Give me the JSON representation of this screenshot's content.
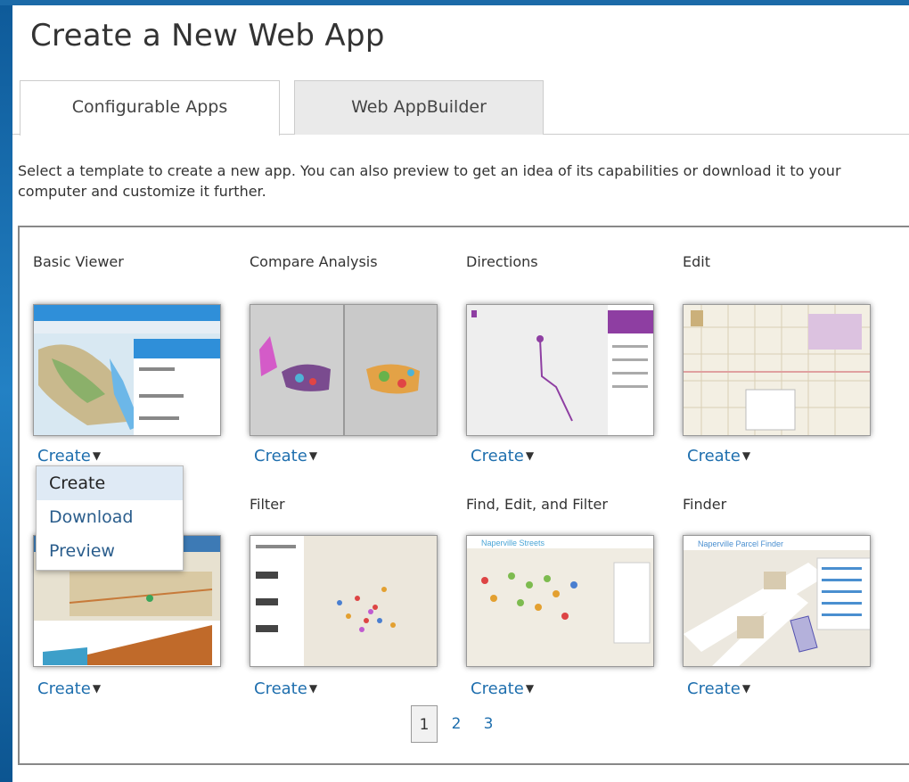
{
  "page": {
    "title": "Create a New Web App",
    "intro": "Select a template to create a new app. You can also preview to get an idea of its capabilities or download it to your computer and customize it further."
  },
  "tabs": [
    {
      "label": "Configurable Apps",
      "active": true
    },
    {
      "label": "Web AppBuilder",
      "active": false
    }
  ],
  "apps": [
    {
      "name": "Basic Viewer",
      "thumb": "map-thumbnail-basic-viewer"
    },
    {
      "name": "Compare Analysis",
      "thumb": "map-thumbnail-compare-analysis"
    },
    {
      "name": "Directions",
      "thumb": "map-thumbnail-directions"
    },
    {
      "name": "Edit",
      "thumb": "map-thumbnail-edit"
    },
    {
      "name": "",
      "thumb": "map-thumbnail-elevation"
    },
    {
      "name": "Filter",
      "thumb": "map-thumbnail-filter"
    },
    {
      "name": "Find, Edit, and Filter",
      "thumb": "map-thumbnail-find-edit-filter"
    },
    {
      "name": "Finder",
      "thumb": "map-thumbnail-finder"
    }
  ],
  "create_label": "Create",
  "dropdown": {
    "items": [
      "Create",
      "Download",
      "Preview"
    ],
    "highlighted": "Create"
  },
  "pagination": {
    "pages": [
      "1",
      "2",
      "3"
    ],
    "current": "1"
  },
  "thumb_texts": {
    "finder_title": "Naperville Parcel Finder",
    "fef_title": "Naperville Streets"
  },
  "colors": {
    "link": "#1f6fae",
    "frame": "#1f6fae",
    "tab_inactive_bg": "#eaeaea",
    "dropdown_highlight": "#dfeaf5"
  }
}
